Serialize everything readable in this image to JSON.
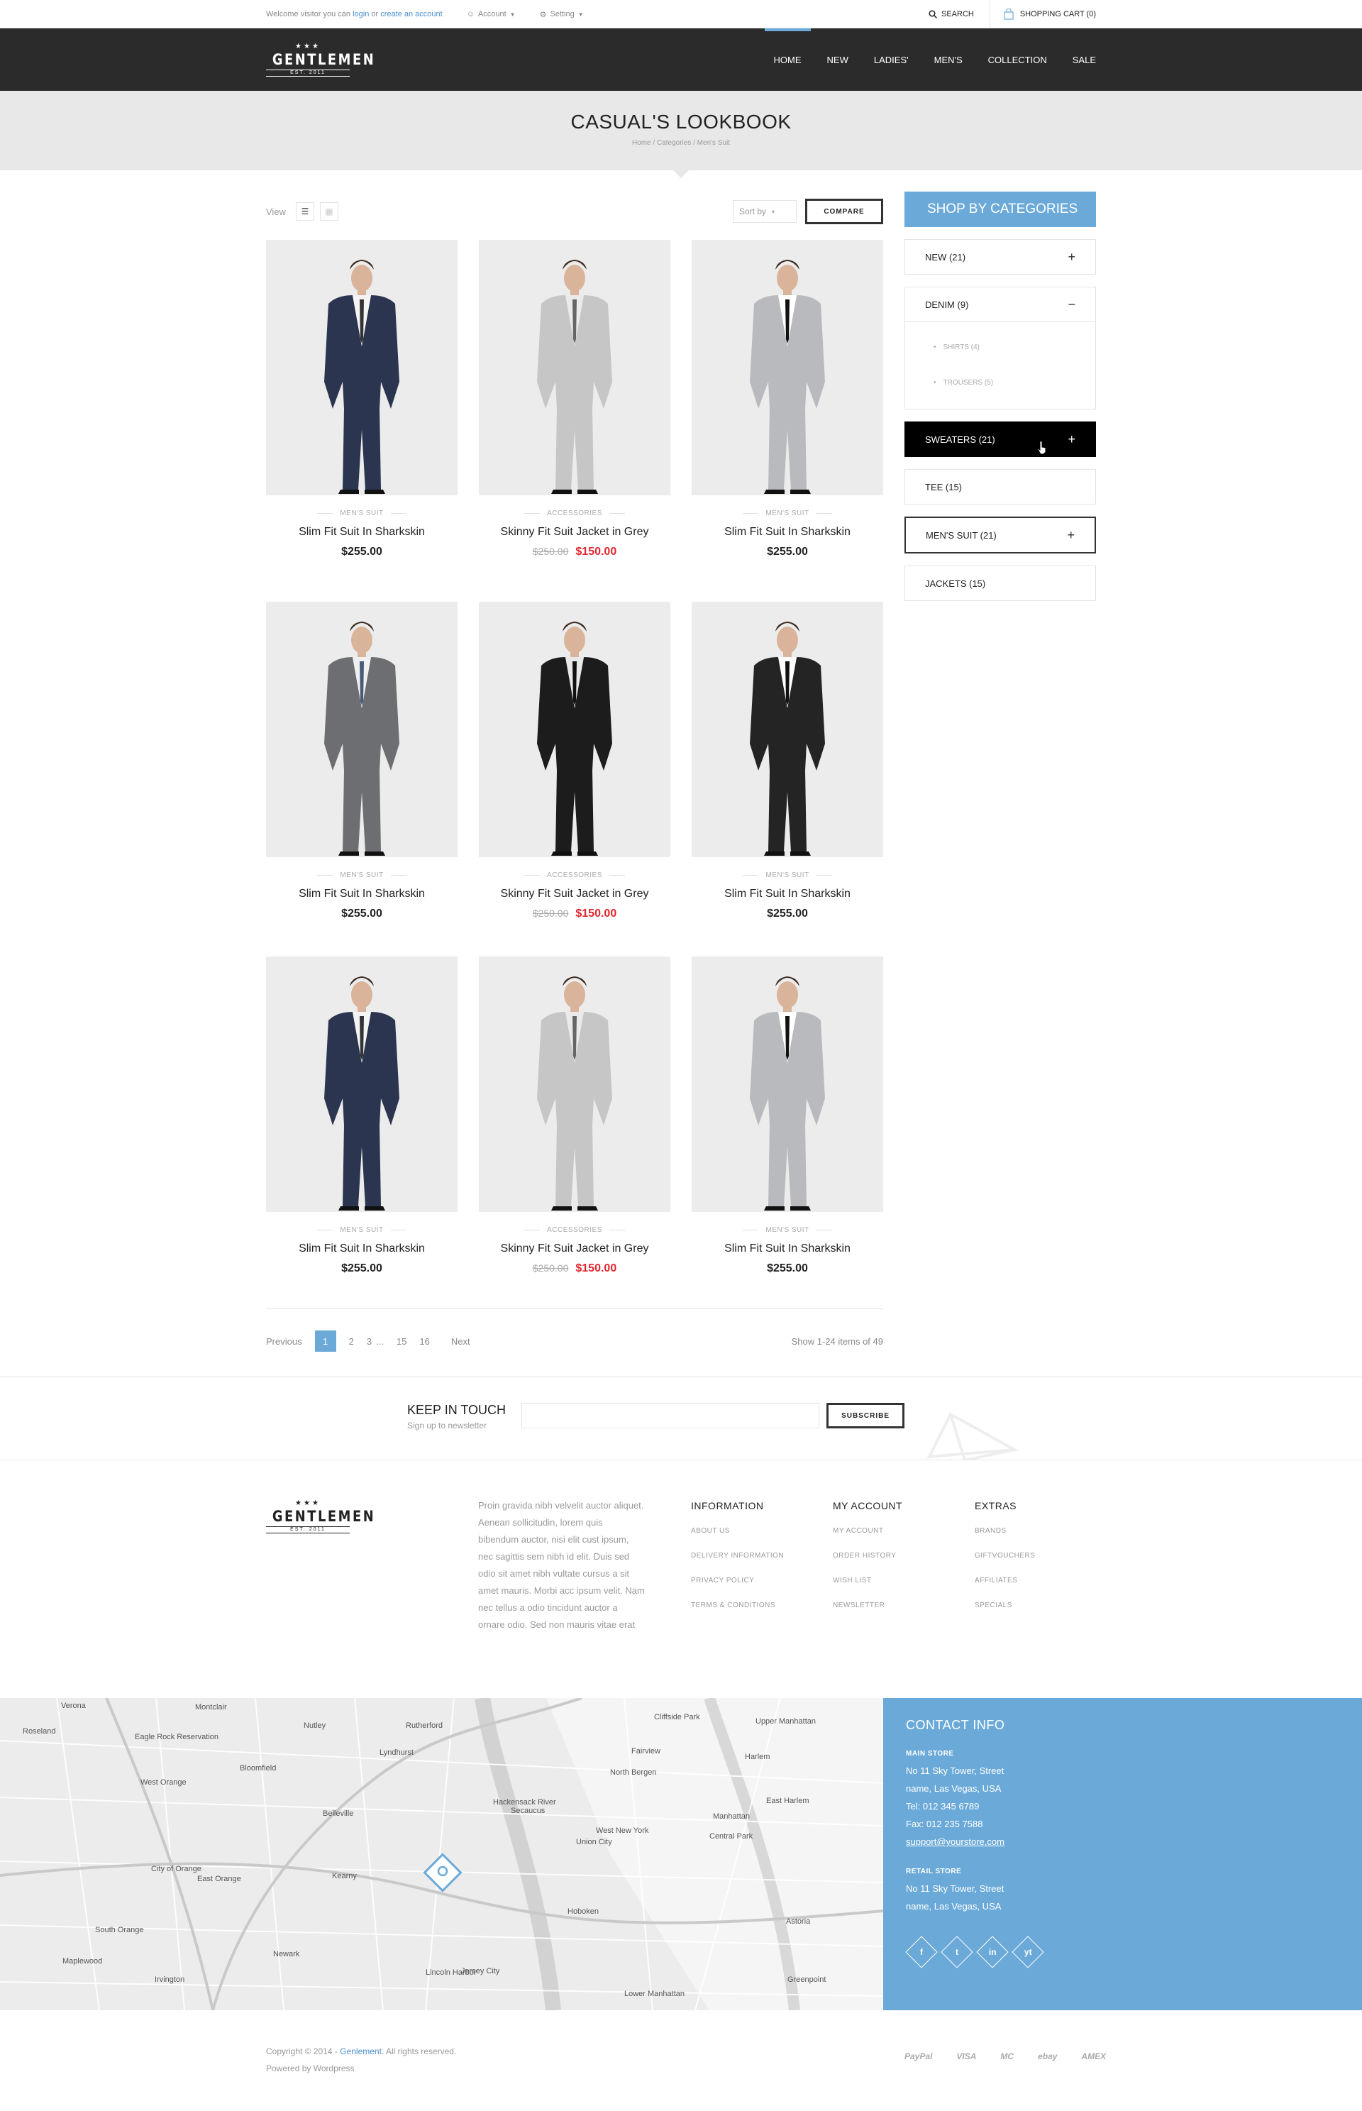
{
  "topbar": {
    "welcome_prefix": "Welcome visitor you can",
    "login": "login",
    "or": "or",
    "create_account": "create an account",
    "account": "Account",
    "setting": "Setting",
    "search": "SEARCH",
    "cart": "SHOPPING CART (0)"
  },
  "header": {
    "logo_name": "GENTLEMEN",
    "logo_est": "EST. 2011",
    "nav": [
      "HOME",
      "NEW",
      "LADIES'",
      "MEN'S",
      "COLLECTION",
      "SALE"
    ]
  },
  "page": {
    "title": "CASUAL'S LOOKBOOK",
    "crumbs": [
      "Home",
      "Categories",
      "Men's Suit"
    ]
  },
  "toolbar": {
    "view_label": "View",
    "sort_label": "Sort by",
    "compare": "COMPARE"
  },
  "products": [
    {
      "category": "MEN'S SUIT",
      "title": "Slim Fit Suit In Sharkskin",
      "price": "$255.00",
      "old_price": "",
      "suit": "#2b3550",
      "shirt": "#f4f4f4",
      "tie": "#333"
    },
    {
      "category": "ACCESSORIES",
      "title": "Skinny Fit Suit Jacket in Grey",
      "price": "$150.00",
      "old_price": "$250.00",
      "suit": "#c6c6c6",
      "shirt": "#eaeaea",
      "tie": "#666"
    },
    {
      "category": "MEN'S SUIT",
      "title": "Slim Fit Suit In Sharkskin",
      "price": "$255.00",
      "old_price": "",
      "suit": "#b8babd",
      "shirt": "#ffffff",
      "tie": "#111"
    },
    {
      "category": "MEN'S SUIT",
      "title": "Slim Fit Suit In Sharkskin",
      "price": "$255.00",
      "old_price": "",
      "suit": "#6c6e71",
      "shirt": "#f0f0f0",
      "tie": "#4a5a7a"
    },
    {
      "category": "ACCESSORIES",
      "title": "Skinny Fit Suit Jacket in Grey",
      "price": "$150.00",
      "old_price": "$250.00",
      "suit": "#1c1c1c",
      "shirt": "#e8e8e8",
      "tie": "#111"
    },
    {
      "category": "MEN'S SUIT",
      "title": "Slim Fit Suit In Sharkskin",
      "price": "$255.00",
      "old_price": "",
      "suit": "#242424",
      "shirt": "#ffffff",
      "tie": "#111"
    },
    {
      "category": "MEN'S SUIT",
      "title": "Slim Fit Suit In Sharkskin",
      "price": "$255.00",
      "old_price": "",
      "suit": "#2b3550",
      "shirt": "#f4f4f4",
      "tie": "#333"
    },
    {
      "category": "ACCESSORIES",
      "title": "Skinny Fit Suit Jacket in Grey",
      "price": "$150.00",
      "old_price": "$250.00",
      "suit": "#c6c6c6",
      "shirt": "#eaeaea",
      "tie": "#666"
    },
    {
      "category": "MEN'S SUIT",
      "title": "Slim Fit Suit In Sharkskin",
      "price": "$255.00",
      "old_price": "",
      "suit": "#b8babd",
      "shirt": "#ffffff",
      "tie": "#111"
    }
  ],
  "pager": {
    "previous": "Previous",
    "pages": [
      "1",
      "2",
      "3",
      "...",
      "15",
      "16"
    ],
    "current": "1",
    "next": "Next",
    "info": "Show 1-24 items of 49"
  },
  "sidebar": {
    "heading": "SHOP BY CATEGORIES",
    "items": [
      {
        "label": "NEW (21)",
        "sign": "+"
      },
      {
        "label": "DENIM (9)",
        "sign": "−",
        "sub": [
          "SHIRTS (4)",
          "TROUSERS (5)"
        ]
      },
      {
        "label": "SWEATERS (21)",
        "sign": "+"
      },
      {
        "label": "TEE (15)",
        "sign": ""
      },
      {
        "label": "MEN'S SUIT (21)",
        "sign": "+"
      },
      {
        "label": "JACKETS (15)",
        "sign": ""
      }
    ]
  },
  "newsletter": {
    "title": "KEEP IN TOUCH",
    "subtitle": "Sign up to newsletter",
    "button": "SUBSCRIBE"
  },
  "footer": {
    "about": "Proin gravida nibh velvelit auctor aliquet. Aenean sollicitudin, lorem quis bibendum auctor, nisi elit cust ipsum, nec sagittis sem nibh id elit. Duis sed odio sit amet nibh vultate cursus a sit amet mauris. Morbi acc ipsum velit. Nam nec tellus a odio tincidunt auctor a ornare odio. Sed non mauris vitae erat",
    "columns": [
      {
        "title": "INFORMATION",
        "links": [
          "ABOUT US",
          "DELIVERY INFORMATION",
          "PRIVACY POLICY",
          "TERMS & CONDITIONS"
        ]
      },
      {
        "title": "MY ACCOUNT",
        "links": [
          "MY ACCOUNT",
          "ORDER HISTORY",
          "WISH LIST",
          "NEWSLETTER"
        ]
      },
      {
        "title": "EXTRAS",
        "links": [
          "BRANDS",
          "GIFTVOUCHERS",
          "AFFILIATES",
          "SPECIALS"
        ]
      }
    ]
  },
  "map": {
    "labels": [
      "Verona",
      "Montclair",
      "Nutley",
      "Rutherford",
      "Cliffside Park",
      "Roseland",
      "Eagle Rock Reservation",
      "Bloomfield",
      "Lyndhurst",
      "Fairview",
      "West Orange",
      "Belleville",
      "North Bergen",
      "Upper Manhattan",
      "Harlem",
      "Secaucus",
      "West New York",
      "Central Park",
      "Manhattan",
      "Union City",
      "City of Orange",
      "East Orange",
      "Kearny",
      "Hoboken",
      "Newark",
      "Jersey City",
      "Irvington",
      "Maplewood",
      "South Orange",
      "Lower Manhattan",
      "Greenpoint",
      "Astoria",
      "Hackensack River",
      "Lincoln Harbor",
      "East Harlem"
    ]
  },
  "contact": {
    "title": "CONTACT INFO",
    "main_store": "MAIN STORE",
    "main_address_1": "No 11 Sky Tower, Street",
    "main_address_2": "name, Las Vegas, USA",
    "tel": "Tel: 012 345 6789",
    "fax": "Fax: 012 235 7588",
    "email": "support@yourstore.com",
    "retail_store": "RETAIL STORE",
    "retail_address_1": "No 11 Sky Tower, Street",
    "retail_address_2": "name, Las Vegas, USA",
    "socials": [
      "f",
      "t",
      "in",
      "yt"
    ]
  },
  "copyright": {
    "prefix": "Copyright © 2014 - ",
    "brand": "Genlement",
    "suffix": ". All rights reserved.",
    "powered": "Powered by Wordpress",
    "payments": [
      "PayPal",
      "VISA",
      "MC",
      "ebay",
      "AMEX"
    ]
  },
  "colors": {
    "accent": "#6baad8",
    "header_bg": "#2b2b2b",
    "sale": "#e2262e"
  }
}
